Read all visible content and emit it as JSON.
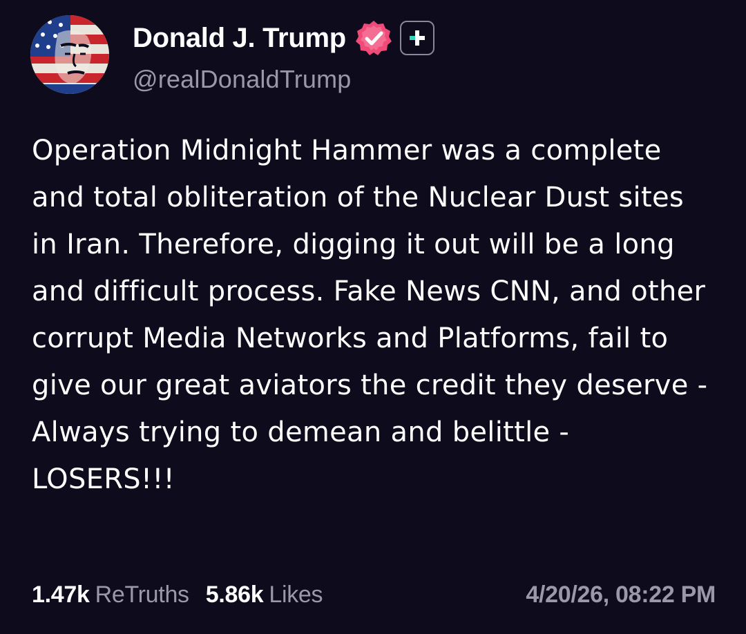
{
  "author": {
    "display_name": "Donald J. Trump",
    "handle": "@realDonaldTrump",
    "avatar_icon": "flag-portrait-avatar",
    "verified_icon": "verified-badge-icon",
    "plus_icon": "add-plus-icon"
  },
  "post": {
    "text": "Operation Midnight Hammer was a complete and total obliteration of the Nuclear Dust sites in Iran. Therefore, digging it out will be a long and difficult process. Fake News CNN, and other corrupt Media Networks and Platforms, fail to give our great aviators the credit they deserve - Always trying to demean and belittle - LOSERS!!!"
  },
  "stats": {
    "retruths_count": "1.47k",
    "retruths_label": "ReTruths",
    "likes_count": "5.86k",
    "likes_label": "Likes"
  },
  "timestamp": "4/20/26, 08:22 PM",
  "colors": {
    "background": "#0e0b1d",
    "primary_text": "#ffffff",
    "secondary_text": "#9b98aa",
    "verified_badge": "#ef4a78",
    "plus_accent": "#2fd6b8"
  }
}
